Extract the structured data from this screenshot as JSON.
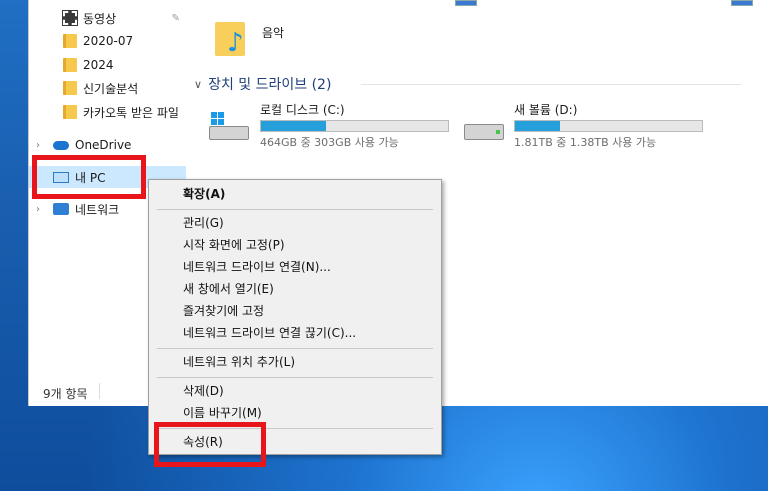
{
  "nav": {
    "items": [
      {
        "label": "동영상",
        "icon": "video-icon"
      },
      {
        "label": "2020-07",
        "icon": "folder-icon"
      },
      {
        "label": "2024",
        "icon": "folder-icon"
      },
      {
        "label": "신기술분석",
        "icon": "folder-icon"
      },
      {
        "label": "카카오톡 받은 파일",
        "icon": "folder-icon"
      },
      {
        "label": "OneDrive",
        "icon": "cloud-icon"
      },
      {
        "label": "내 PC",
        "icon": "pc-icon"
      },
      {
        "label": "네트워크",
        "icon": "network-icon"
      }
    ],
    "status": "9개 항목"
  },
  "content": {
    "music_label": "음악",
    "section_title": "장치 및 드라이브 (2)",
    "drives": [
      {
        "name": "로컬 디스크 (C:)",
        "info": "464GB 중 303GB 사용 가능",
        "used_fraction": 0.35,
        "icon": "windows-drive-icon"
      },
      {
        "name": "새 볼륨 (D:)",
        "info": "1.81TB 중 1.38TB 사용 가능",
        "used_fraction": 0.24,
        "icon": "hdd-icon"
      }
    ]
  },
  "context_menu": {
    "items": [
      {
        "label": "확장(A)",
        "bold": true
      },
      {
        "label": "관리(G)"
      },
      {
        "label": "시작 화면에 고정(P)"
      },
      {
        "label": "네트워크 드라이브 연결(N)..."
      },
      {
        "label": "새 창에서 열기(E)"
      },
      {
        "label": "즐겨찾기에 고정"
      },
      {
        "label": "네트워크 드라이브 연결 끊기(C)..."
      },
      {
        "label": "네트워크 위치 추가(L)"
      },
      {
        "label": "삭제(D)"
      },
      {
        "label": "이름 바꾸기(M)"
      },
      {
        "label": "속성(R)"
      }
    ]
  },
  "colors": {
    "highlight": "#e8161a",
    "drive_bar": "#26a0da",
    "selection": "#cce8ff"
  }
}
